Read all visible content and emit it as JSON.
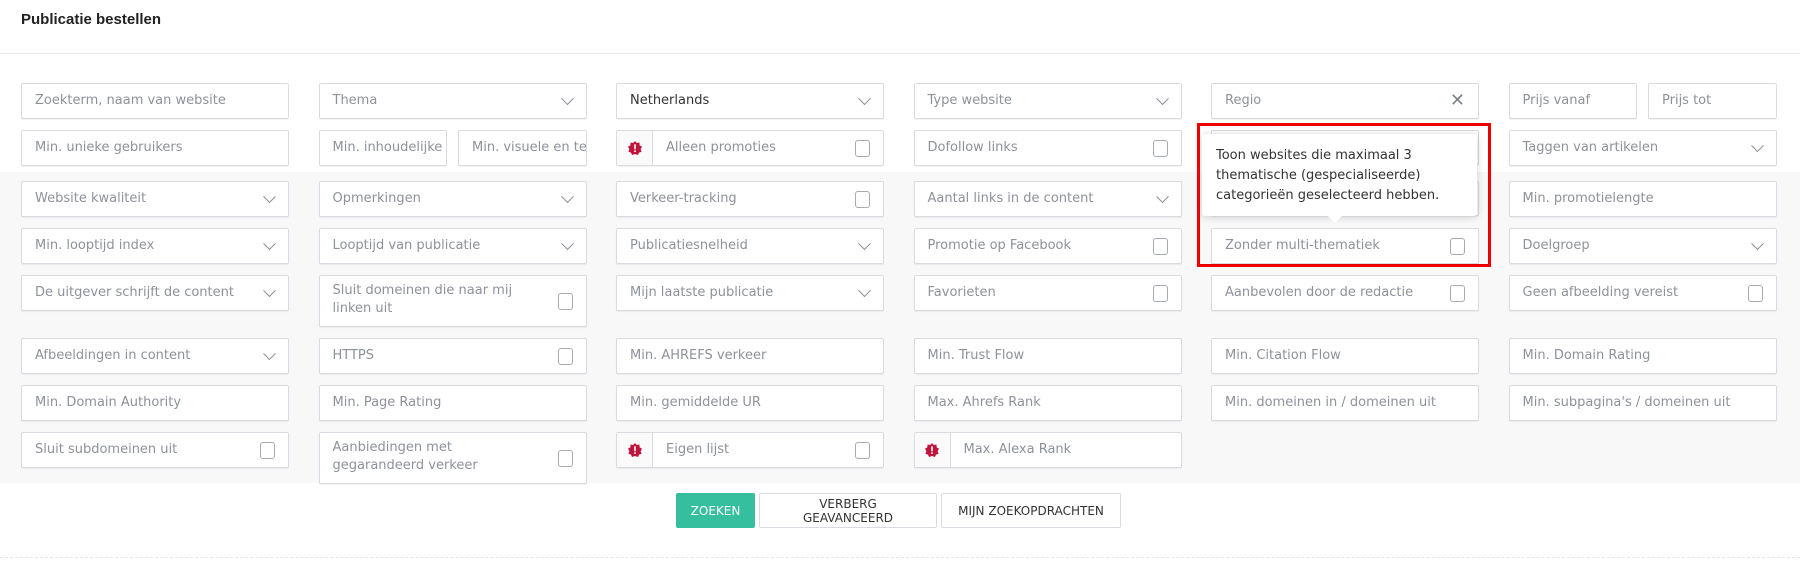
{
  "page": {
    "title": "Publicatie bestellen"
  },
  "colors": {
    "accent": "#35bf9f",
    "badge": "#c0143c",
    "highlight": "#ee0000"
  },
  "basic_rows": [
    [
      {
        "label": "Zoekterm, naam van website",
        "type": "text"
      },
      {
        "label": "Thema",
        "type": "select"
      },
      {
        "label": "Netherlands",
        "type": "select",
        "value": true
      },
      {
        "label": "Type website",
        "type": "select"
      },
      {
        "label": "Regio",
        "type": "clear"
      },
      {
        "split": [
          {
            "label": "Prijs vanaf",
            "type": "text"
          },
          {
            "label": "Prijs tot",
            "type": "text"
          }
        ]
      }
    ],
    [
      {
        "label": "Min. unieke gebruikers",
        "type": "text"
      },
      {
        "split": [
          {
            "label": "Min. inhoudelijke",
            "type": "text"
          },
          {
            "label": "Min. visuele en te",
            "type": "text"
          }
        ]
      },
      {
        "label": "Alleen promoties",
        "type": "check",
        "badge": true
      },
      {
        "label": "Dofollow links",
        "type": "check"
      },
      {
        "label": "",
        "type": "text"
      },
      {
        "label": "Taggen van artikelen",
        "type": "select"
      }
    ]
  ],
  "advanced_rows": [
    [
      {
        "label": "Website kwaliteit",
        "type": "select"
      },
      {
        "label": "Opmerkingen",
        "type": "select"
      },
      {
        "label": "Verkeer-tracking",
        "type": "check"
      },
      {
        "label": "Aantal links in de content",
        "type": "select"
      },
      {
        "label": "",
        "type": "text"
      },
      {
        "label": "Min. promotielengte",
        "type": "text"
      }
    ],
    [
      {
        "label": "Min. looptijd index",
        "type": "select"
      },
      {
        "label": "Looptijd van publicatie",
        "type": "select"
      },
      {
        "label": "Publicatiesnelheid",
        "type": "select"
      },
      {
        "label": "Promotie op Facebook",
        "type": "check"
      },
      {
        "label": "Zonder multi-thematiek",
        "type": "check"
      },
      {
        "label": "Doelgroep",
        "type": "select"
      }
    ],
    [
      {
        "label": "De uitgever schrijft de content",
        "type": "select"
      },
      {
        "label": "Sluit domeinen die naar mij linken uit",
        "type": "check",
        "tall": true
      },
      {
        "label": "Mijn laatste publicatie",
        "type": "select"
      },
      {
        "label": "Favorieten",
        "type": "check"
      },
      {
        "label": "Aanbevolen door de redactie",
        "type": "check"
      },
      {
        "label": "Geen afbeelding vereist",
        "type": "check"
      }
    ],
    [
      {
        "label": "Afbeeldingen in content",
        "type": "select"
      },
      {
        "label": "HTTPS",
        "type": "check"
      },
      {
        "label": "Min. AHREFS verkeer",
        "type": "text"
      },
      {
        "label": "Min. Trust Flow",
        "type": "text"
      },
      {
        "label": "Min. Citation Flow",
        "type": "text"
      },
      {
        "label": "Min. Domain Rating",
        "type": "text"
      }
    ],
    [
      {
        "label": "Min. Domain Authority",
        "type": "text"
      },
      {
        "label": "Min. Page Rating",
        "type": "text"
      },
      {
        "label": "Min. gemiddelde UR",
        "type": "text"
      },
      {
        "label": "Max. Ahrefs Rank",
        "type": "text"
      },
      {
        "label": "Min. domeinen in / domeinen uit",
        "type": "text"
      },
      {
        "label": "Min. subpagina's / domeinen uit",
        "type": "text"
      }
    ],
    [
      {
        "label": "Sluit subdomeinen uit",
        "type": "check"
      },
      {
        "label": "Aanbiedingen met gegarandeerd verkeer",
        "type": "check",
        "tall": true
      },
      {
        "label": "Eigen lijst",
        "type": "check",
        "badge": true
      },
      {
        "label": "Max. Alexa Rank",
        "type": "text",
        "badge": true
      }
    ]
  ],
  "tooltip": {
    "text": "Toon websites die maximaal 3 thematische (gespecialiseerde) categorieën geselecteerd hebben."
  },
  "buttons": {
    "search": "ZOEKEN",
    "hide_advanced": "VERBERG GEAVANCEERD",
    "my_searches": "MIJN ZOEKOPDRACHTEN"
  }
}
